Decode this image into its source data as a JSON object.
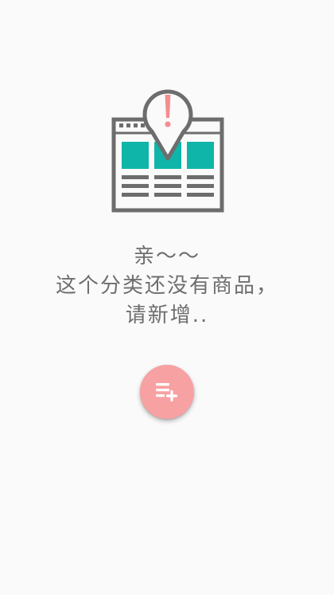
{
  "empty_state": {
    "illustration_icon": "empty-list-warning-illustration",
    "lines": [
      "亲～～",
      "这个分类还没有商品，",
      "请新增.."
    ]
  },
  "fab": {
    "icon": "playlist-add-icon",
    "color": "#f7a1a3"
  },
  "colors": {
    "background": "#fafafa",
    "illustration_gray": "#6d6d6d",
    "illustration_teal": "#0fb5a8",
    "illustration_pink": "#f58c8f",
    "text": "#6e6e6e"
  }
}
